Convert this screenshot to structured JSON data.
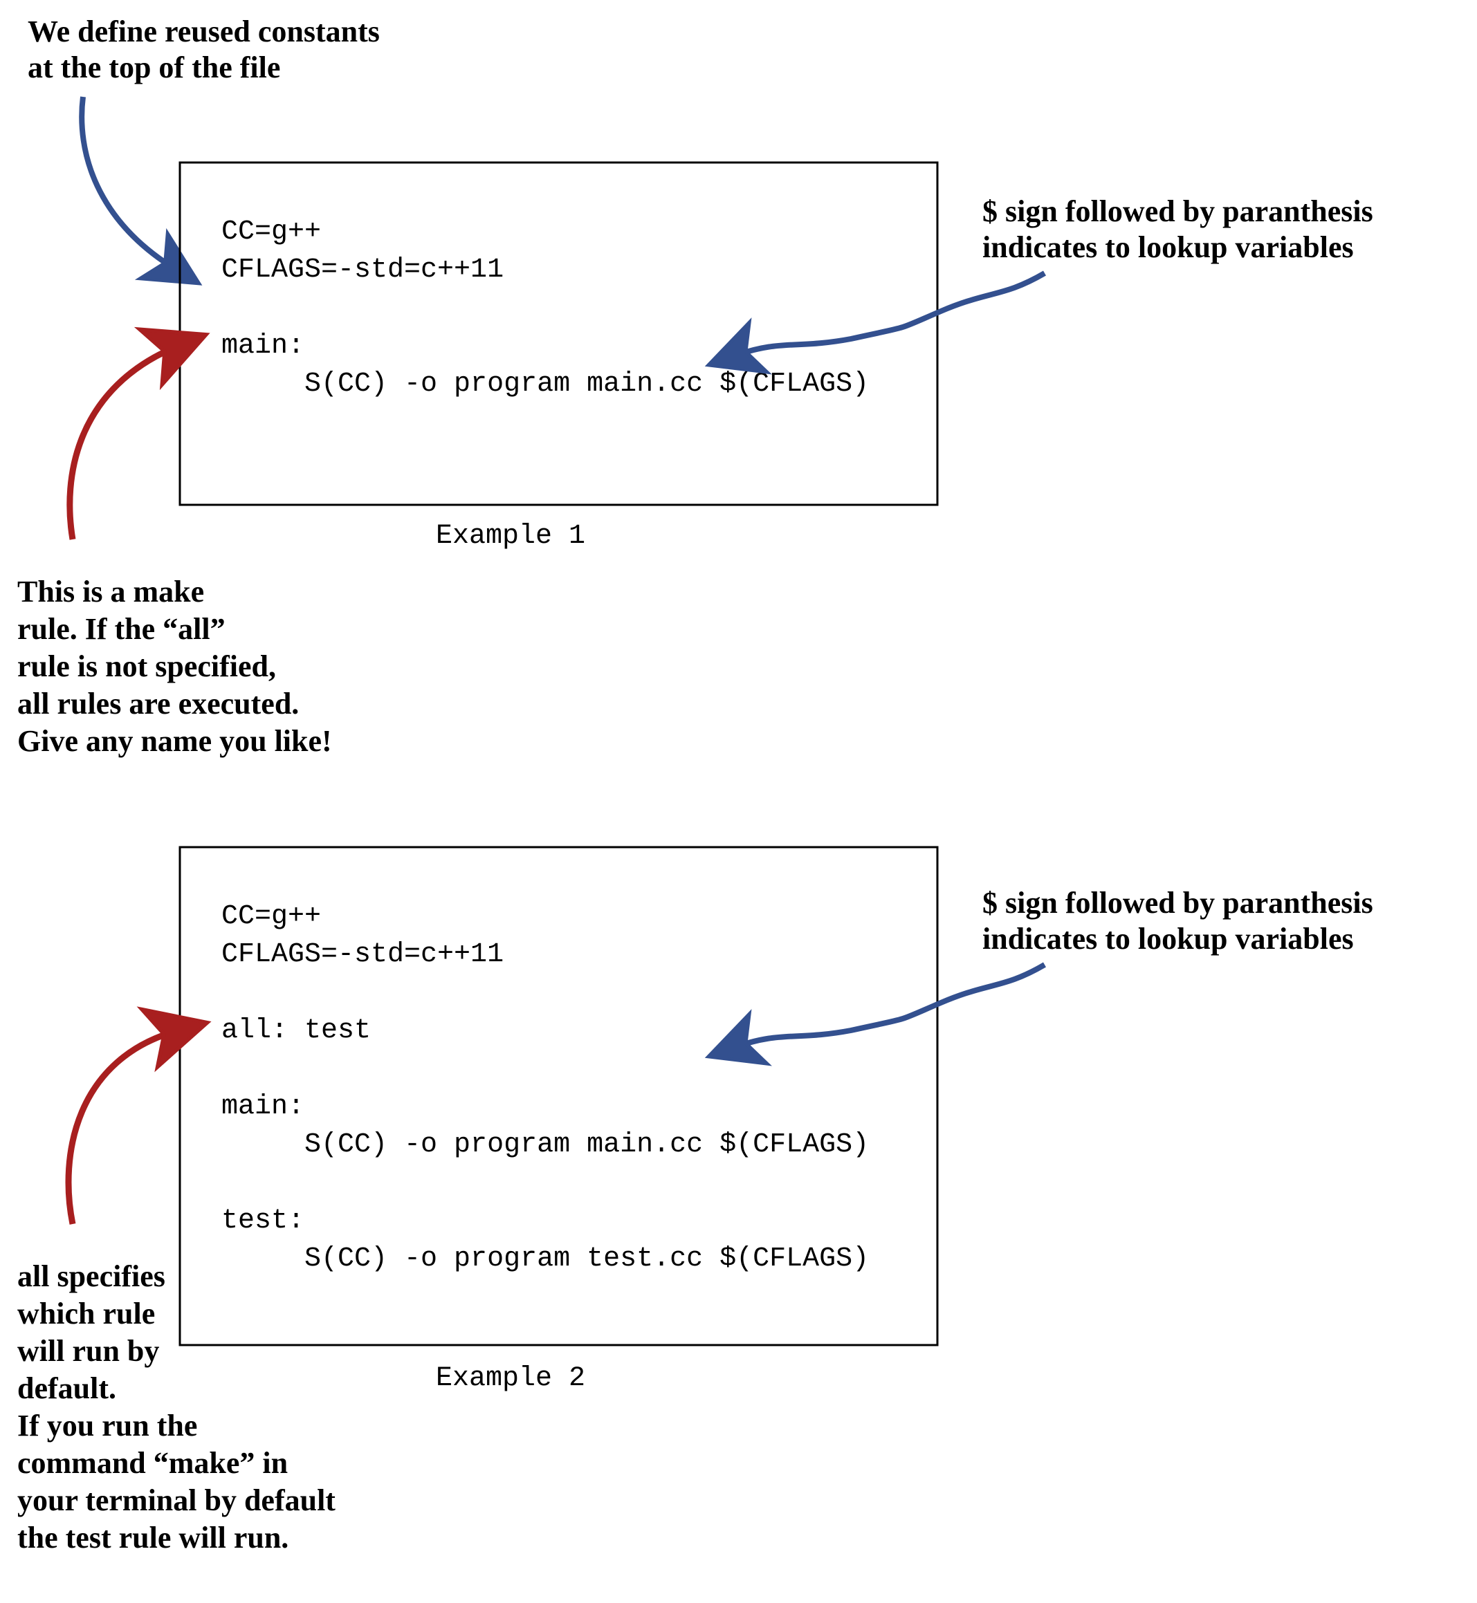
{
  "annotations": {
    "top_constants": "We define reused constants\nat the top of the file",
    "make_rule": "This is a make\nrule. If the “all”\nrule is not specified,\nall rules are executed.\nGive any name you like!",
    "dollar_sign_1": "$ sign followed by paranthesis\nindicates to lookup variables",
    "dollar_sign_2": "$ sign followed by paranthesis\nindicates to lookup variables",
    "all_specifies": "all specifies\nwhich rule\nwill run by\ndefault.\nIf you run the\ncommand “make” in\nyour terminal by default\nthe test rule will run."
  },
  "example1": {
    "caption": "Example 1",
    "code": {
      "l1": "CC=g++",
      "l2": "CFLAGS=-std=c++11",
      "l3": "",
      "l4": "main:",
      "l5": "     S(CC) -o program main.cc $(CFLAGS)"
    }
  },
  "example2": {
    "caption": "Example 2",
    "code": {
      "l1": "CC=g++",
      "l2": "CFLAGS=-std=c++11",
      "l3": "",
      "l4": "all: test",
      "l5": "",
      "l6": "main:",
      "l7": "     S(CC) -o program main.cc $(CFLAGS)",
      "l8": "",
      "l9": "test:",
      "l10": "     S(CC) -o program test.cc $(CFLAGS)"
    }
  },
  "colors": {
    "blue": "#33508f",
    "red": "#a81f1f"
  }
}
